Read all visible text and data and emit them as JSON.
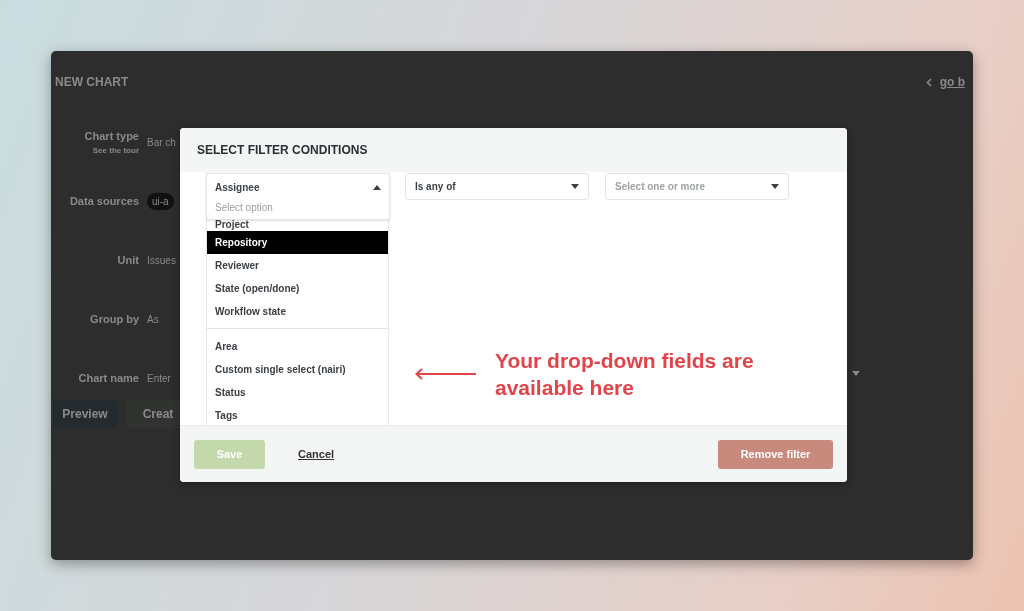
{
  "window": {
    "title": "NEW CHART",
    "back_link": "go b"
  },
  "form": [
    {
      "label": "Chart type",
      "hint": "See the tour",
      "kind": "select",
      "value": "Bar ch"
    },
    {
      "label": "Data sources",
      "kind": "chip",
      "value": "ui-a"
    },
    {
      "label": "Unit",
      "kind": "select",
      "value": "Issues"
    },
    {
      "label": "Group by",
      "kind": "select",
      "value": "As"
    },
    {
      "label": "Chart name",
      "kind": "input",
      "placeholder": "Enter"
    }
  ],
  "form_buttons": [
    "Preview",
    "Creat"
  ],
  "modal": {
    "title": "SELECT FILTER CONDITIONS",
    "field_select": {
      "value": "Assignee",
      "expanded": true,
      "placeholder": "Select option",
      "option_groups": [
        [
          {
            "label": "Project",
            "selected": false
          },
          {
            "label": "Repository",
            "selected": true
          },
          {
            "label": "Reviewer",
            "selected": false
          },
          {
            "label": "State (open/done)",
            "selected": false
          },
          {
            "label": "Workflow state",
            "selected": false
          }
        ],
        [
          {
            "label": "Area",
            "selected": false
          },
          {
            "label": "Custom single select (nairi)",
            "selected": false
          },
          {
            "label": "Status",
            "selected": false
          },
          {
            "label": "Tags",
            "selected": false
          }
        ]
      ]
    },
    "operator_select": {
      "value": "Is any of",
      "expanded": false
    },
    "values_select": {
      "placeholder": "Select one or more",
      "expanded": false
    },
    "annotation": "Your drop-down fields are available here",
    "save": {
      "label": "Save",
      "disabled": true
    },
    "cancel": "Cancel",
    "remove": "Remove filter"
  }
}
